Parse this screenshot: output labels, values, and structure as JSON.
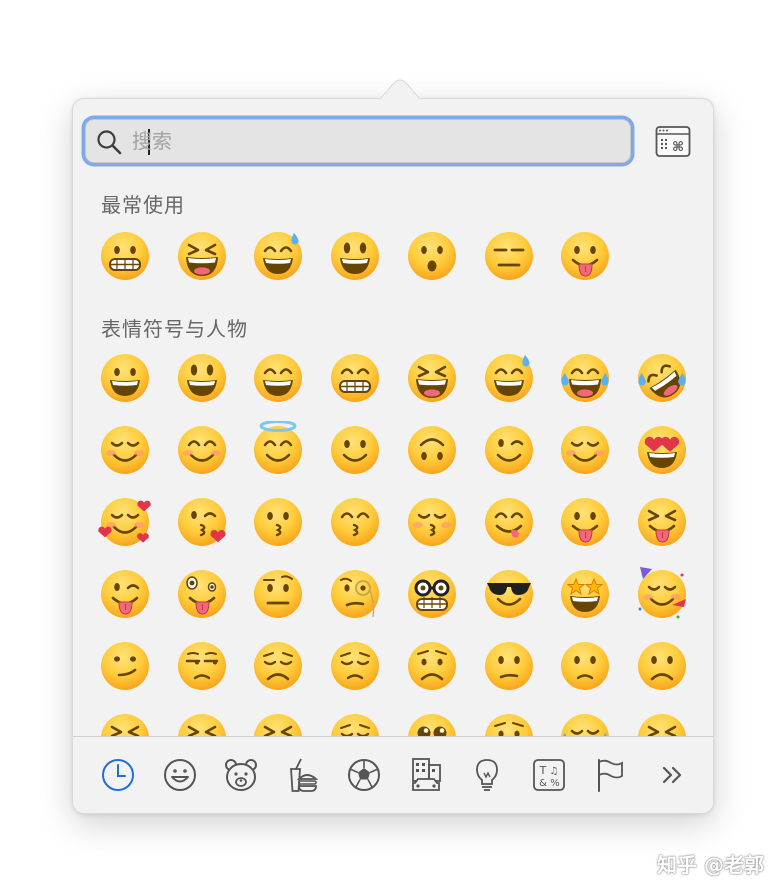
{
  "search": {
    "placeholder": "搜索",
    "value": ""
  },
  "icons": {
    "search": "magnifier-icon",
    "character_viewer": "character-viewer-icon"
  },
  "sections": [
    {
      "title": "最常使用",
      "emojis": [
        "grimacing",
        "squinting",
        "sweat-smile",
        "grinning-big-eyes",
        "frowning-open-mouth",
        "expressionless",
        "tongue-out"
      ]
    },
    {
      "title": "表情符号与人物",
      "emojis": [
        "grinning",
        "grinning-big-eyes",
        "grinning-smiling-eyes",
        "beaming",
        "squinting",
        "sweat-smile",
        "joy",
        "rofl",
        "relaxed",
        "blush",
        "innocent",
        "slightly-smiling",
        "upside-down",
        "wink",
        "relieved",
        "heart-eyes",
        "smiling-hearts",
        "kissing-heart",
        "kissing",
        "kissing-smiling-eyes",
        "kissing-closed-eyes",
        "yum",
        "tongue-out",
        "squinting-tongue",
        "winking-tongue",
        "zany",
        "raised-eyebrow",
        "monocle",
        "nerd",
        "sunglasses",
        "star-struck",
        "partying",
        "smirk",
        "unamused",
        "disappointed",
        "pensive",
        "worried",
        "confused",
        "slightly-frowning",
        "frowning",
        "persevering",
        "tired",
        "confounded",
        "weary",
        "pleading",
        "crying",
        "loudly-crying",
        "steam"
      ]
    }
  ],
  "tabs": [
    {
      "name": "frequently-used",
      "icon": "clock-icon",
      "active": true
    },
    {
      "name": "smileys-people",
      "icon": "smiley-icon",
      "active": false
    },
    {
      "name": "animals-nature",
      "icon": "bear-icon",
      "active": false
    },
    {
      "name": "food-drink",
      "icon": "burger-drink-icon",
      "active": false
    },
    {
      "name": "activity",
      "icon": "soccer-ball-icon",
      "active": false
    },
    {
      "name": "travel-places",
      "icon": "building-car-icon",
      "active": false
    },
    {
      "name": "objects",
      "icon": "lightbulb-icon",
      "active": false
    },
    {
      "name": "symbols",
      "icon": "symbols-icon",
      "active": false
    },
    {
      "name": "flags",
      "icon": "flag-icon",
      "active": false
    },
    {
      "name": "more",
      "icon": "double-chevron-right-icon",
      "active": false
    }
  ],
  "colors": {
    "accent": "#1f6fd6",
    "focus_ring": "#7fa9e9",
    "panel_bg": "#f2f2f2",
    "emoji_yellow": "#ffcd3c",
    "emoji_orange": "#f7a21b"
  },
  "watermark": "知乎 @老郭"
}
